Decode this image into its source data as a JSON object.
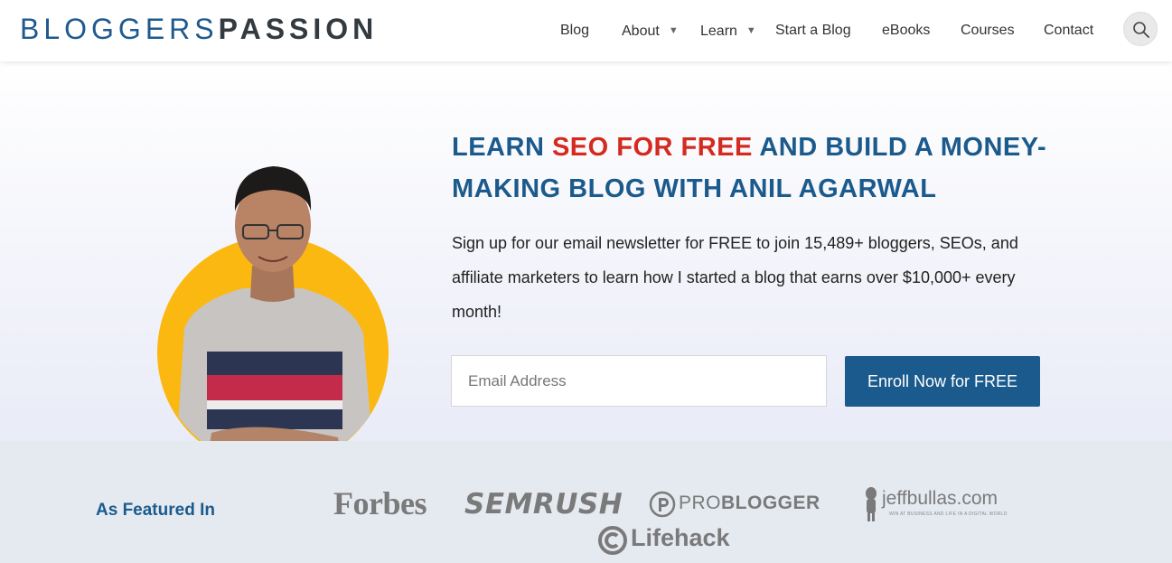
{
  "header": {
    "logo_part1": "BLOGGERS",
    "logo_part2": "PASSION",
    "nav": [
      {
        "label": "Blog"
      },
      {
        "label": "About",
        "has_dropdown": true
      },
      {
        "label": "Learn",
        "has_dropdown": true
      },
      {
        "label": "Start a Blog"
      },
      {
        "label": "eBooks"
      },
      {
        "label": "Courses"
      },
      {
        "label": "Contact"
      }
    ],
    "search_icon": "search-icon"
  },
  "hero": {
    "headline_part1": "LEARN ",
    "headline_highlight": "SEO FOR FREE",
    "headline_part2": " AND BUILD A MONEY-MAKING BLOG WITH ANIL AGARWAL",
    "description": "Sign up for our email newsletter for FREE to join 15,489+ bloggers, SEOs, and affiliate marketers to learn how I started a blog that earns over $10,000+ every month!",
    "email_placeholder": "Email Address",
    "enroll_label": "Enroll Now for FREE"
  },
  "featured": {
    "label": "As Featured In",
    "logos": {
      "forbes": "Forbes",
      "semrush": "SEMRUSH",
      "problogger_pro": "PRO",
      "problogger_blogger": "BLOGGER",
      "jeffbullas": "jeffbullas.com",
      "jeffbullas_tagline": "WIN AT BUSINESS AND LIFE IN A DIGITAL WORLD",
      "lifehack": "Lifehack"
    }
  },
  "colors": {
    "brand_blue": "#1b5a8c",
    "highlight_red": "#d42a20",
    "avatar_circle": "#fbb810",
    "featured_bg": "#e5eaf1"
  }
}
